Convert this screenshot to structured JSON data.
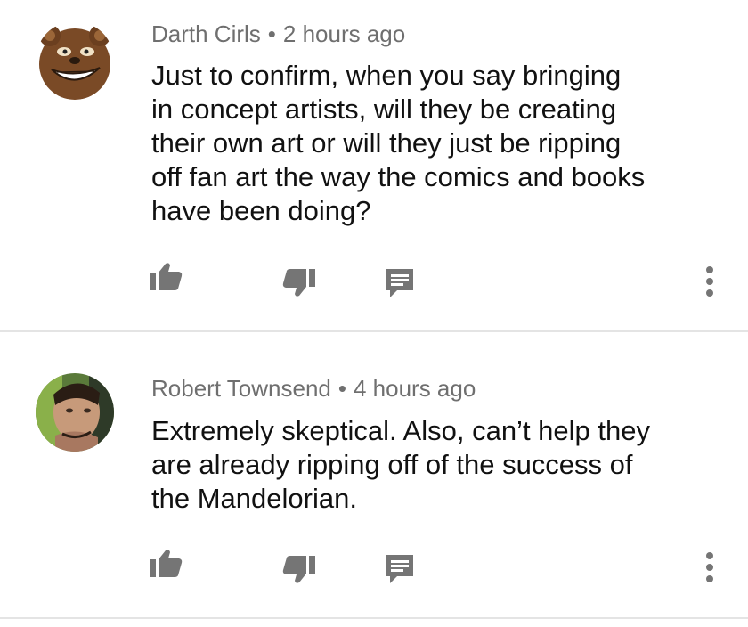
{
  "comments": [
    {
      "author": "Darth Cirls",
      "separator": "•",
      "time": "2 hours ago",
      "text": "Just to confirm, when you say bringing\nin concept artists, will they be creating\ntheir own art or will they just be ripping\noff fan art the way the comics and books\nhave been doing?",
      "avatar_icon": "troll-bear-avatar",
      "actions": [
        "thumbs-up-icon",
        "thumbs-down-icon",
        "reply-icon",
        "more-vert-icon"
      ]
    },
    {
      "author": "Robert Townsend",
      "separator": "•",
      "time": "4 hours ago",
      "text": "Extremely skeptical. Also, can’t help they\nare already ripping off of the success of\nthe Mandelorian.",
      "avatar_icon": "person-photo-avatar",
      "actions": [
        "thumbs-up-icon",
        "thumbs-down-icon",
        "reply-icon",
        "more-vert-icon"
      ]
    }
  ],
  "colors": {
    "meta_text": "#6f6f6f",
    "body_text": "#111111",
    "icon": "#757575",
    "divider": "#e4e4e4",
    "background": "#ffffff"
  }
}
